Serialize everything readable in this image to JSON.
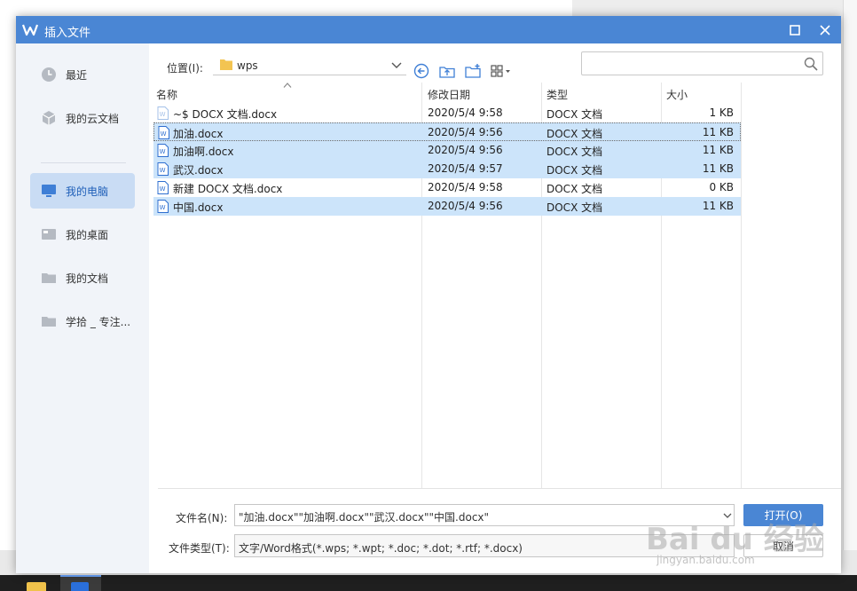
{
  "dialog": {
    "title": "插入文件",
    "colors": {
      "titlebar": "#4a86d4",
      "accent": "#4a86d4",
      "selection": "#cce4fa",
      "sidebar_active": "#c9dcf4"
    }
  },
  "sidebar": {
    "items": [
      {
        "label": "最近",
        "icon": "clock-icon"
      },
      {
        "label": "我的云文档",
        "icon": "cloud-cube-icon"
      },
      {
        "label": "我的电脑",
        "icon": "monitor-icon",
        "active": true
      },
      {
        "label": "我的桌面",
        "icon": "desktop-icon"
      },
      {
        "label": "我的文档",
        "icon": "folder-icon"
      },
      {
        "label": "学拾 _ 专注...",
        "icon": "folder-icon"
      }
    ]
  },
  "toolbar": {
    "location_label": "位置(I):",
    "location_value": "wps",
    "search_placeholder": ""
  },
  "table": {
    "headers": [
      "名称",
      "修改日期",
      "类型",
      "大小"
    ],
    "rows": [
      {
        "name": "~$ DOCX 文档.docx",
        "date": "2020/5/4 9:58",
        "type": "DOCX 文档",
        "size": "1 KB",
        "selected": false,
        "icon": "temp-doc-icon"
      },
      {
        "name": "加油.docx",
        "date": "2020/5/4 9:56",
        "type": "DOCX 文档",
        "size": "11 KB",
        "selected": true,
        "focused": true,
        "icon": "word-doc-icon"
      },
      {
        "name": "加油啊.docx",
        "date": "2020/5/4 9:56",
        "type": "DOCX 文档",
        "size": "11 KB",
        "selected": true,
        "icon": "word-doc-icon"
      },
      {
        "name": "武汉.docx",
        "date": "2020/5/4 9:57",
        "type": "DOCX 文档",
        "size": "11 KB",
        "selected": true,
        "icon": "word-doc-icon"
      },
      {
        "name": "新建 DOCX 文档.docx",
        "date": "2020/5/4 9:58",
        "type": "DOCX 文档",
        "size": "0 KB",
        "selected": false,
        "icon": "word-doc-icon"
      },
      {
        "name": "中国.docx",
        "date": "2020/5/4 9:56",
        "type": "DOCX 文档",
        "size": "11 KB",
        "selected": true,
        "icon": "word-doc-icon"
      }
    ]
  },
  "form": {
    "filename_label": "文件名(N):",
    "filename_value": "\"加油.docx\"\"加油啊.docx\"\"武汉.docx\"\"中国.docx\"",
    "filetype_label": "文件类型(T):",
    "filetype_value": "文字/Word格式(*.wps; *.wpt; *.doc; *.dot; *.rtf; *.docx)",
    "open_button": "打开(O)",
    "cancel_button": "取消"
  },
  "watermark": {
    "text": "Bai du 经验",
    "sub": "jingyan.baidu.com"
  }
}
